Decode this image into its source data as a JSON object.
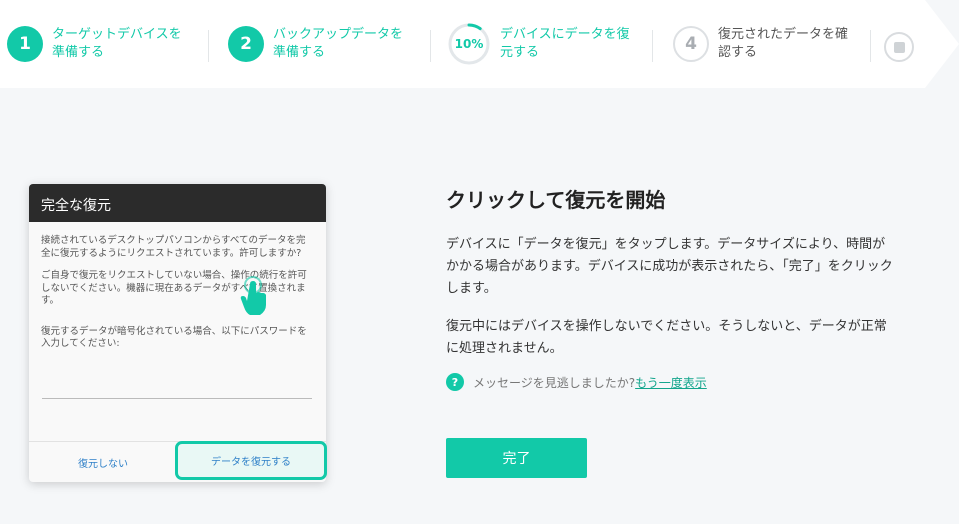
{
  "stepper": {
    "steps": [
      {
        "number": "1",
        "label": "ターゲットデバイスを準備する",
        "state": "done"
      },
      {
        "number": "2",
        "label": "バックアップデータを準備する",
        "state": "done"
      },
      {
        "number": "10%",
        "label": "デバイスにデータを復元する",
        "state": "active",
        "progress": 0.1
      },
      {
        "number": "4",
        "label": "復元されたデータを確認する",
        "state": "todo"
      }
    ],
    "end_icon": "stop-icon"
  },
  "dialog": {
    "title": "完全な復元",
    "paragraph1": "接続されているデスクトップパソコンからすべてのデータを完全に復元するようにリクエストされています。許可しますか?",
    "paragraph2": "ご自身で復元をリクエストしていない場合、操作の続行を許可しないでください。機器に現在あるデータがすべて置換されます。",
    "paragraph3": "復元するデータが暗号化されている場合、以下にパスワードを入力してください:",
    "password_value": "",
    "cancel_label": "復元しない",
    "confirm_label": "データを復元する",
    "pointer_icon": "hand-pointer-icon"
  },
  "main": {
    "title": "クリックして復元を開始",
    "description1": "デバイスに「データを復元」をタップします。データサイズにより、時間がかかる場合があります。デバイスに成功が表示されたら、「完了」をクリックします。",
    "description2": "復元中にはデバイスを操作しないでください。そうしないと、データが正常に処理されません。",
    "help_icon": "?",
    "help_text": "メッセージを見逃しましたか?",
    "help_link": "もう一度表示",
    "done_label": "完了"
  },
  "colors": {
    "accent": "#12c9a8",
    "dialog_header": "#2b2b2b",
    "link_blue": "#2f80c8"
  }
}
